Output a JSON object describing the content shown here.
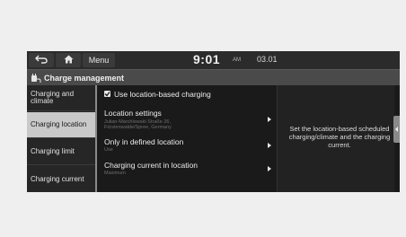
{
  "topbar": {
    "back_icon": "back-arrow-icon",
    "home_icon": "home-icon",
    "menu_label": "Menu",
    "time": "9:01",
    "ampm": "AM",
    "date": "03.01"
  },
  "titlebar": {
    "icon": "ev-plug-icon",
    "title": "Charge management"
  },
  "leftmenu": {
    "items": [
      {
        "label": "Charging and climate"
      },
      {
        "label": "Charging location"
      },
      {
        "label": "Charging limit"
      },
      {
        "label": "Charging current"
      }
    ],
    "active_index": 1
  },
  "content": {
    "checkbox_label": "Use location-based charging",
    "checkbox_checked": true,
    "rows": [
      {
        "title": "Location settings",
        "sub": "Julian-Marchlewski-Straße 26, Fürstenwalde/Spree, Germany"
      },
      {
        "title": "Only in defined location",
        "sub": "Use"
      },
      {
        "title": "Charging current in location",
        "sub": "Maximum"
      }
    ]
  },
  "info": {
    "text": "Set the location-based scheduled charging/climate and the charging current."
  },
  "colors": {
    "screen_bg": "#1a1a1a",
    "active_item_bg": "#c9c9c9",
    "page_bg": "#efefef"
  }
}
